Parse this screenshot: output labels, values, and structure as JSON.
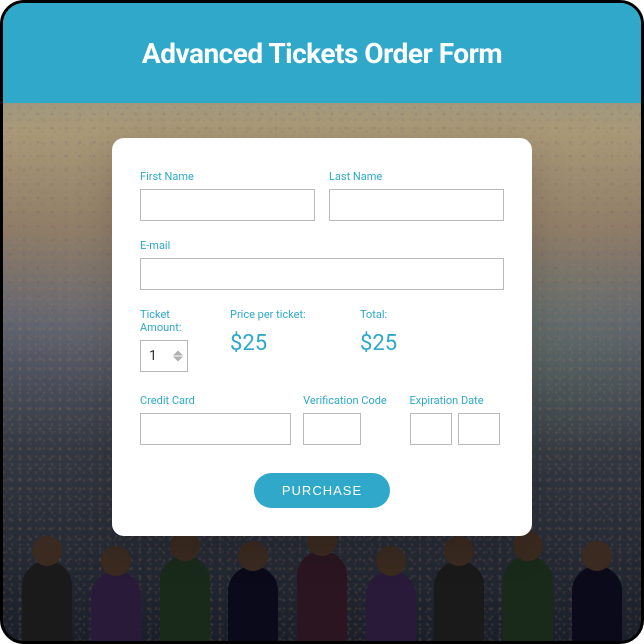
{
  "header": {
    "title": "Advanced Tickets Order Form"
  },
  "form": {
    "first_name": {
      "label": "First Name",
      "value": ""
    },
    "last_name": {
      "label": "Last Name",
      "value": ""
    },
    "email": {
      "label": "E-mail",
      "value": ""
    },
    "ticket_amount": {
      "label": "Ticket Amount:",
      "value": "1"
    },
    "price_per_ticket": {
      "label": "Price per ticket:",
      "value": "$25"
    },
    "total": {
      "label": "Total:",
      "value": "$25"
    },
    "credit_card": {
      "label": "Credit Card",
      "value": ""
    },
    "verification_code": {
      "label": "Verification Code",
      "value": ""
    },
    "expiration_date": {
      "label": "Expiration Date",
      "month": "",
      "year": ""
    },
    "purchase_button": "PURCHASE"
  },
  "colors": {
    "accent": "#2fa8c9"
  }
}
